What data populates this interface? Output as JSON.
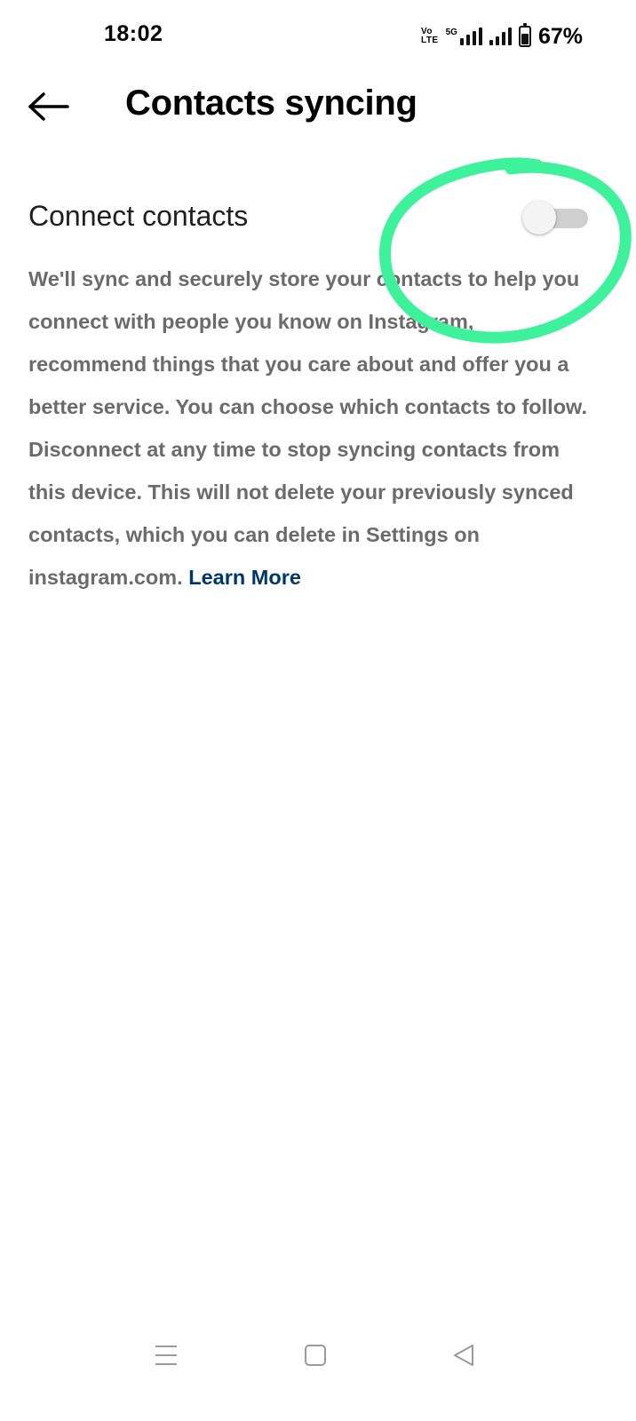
{
  "status_bar": {
    "time": "18:02",
    "volte_line1": "Vo",
    "volte_line2": "LTE",
    "network_label": "5G",
    "battery_percent": "67%",
    "battery_level": 0.67
  },
  "header": {
    "title": "Contacts syncing",
    "back_icon": "arrow-left-icon"
  },
  "setting": {
    "label": "Connect contacts",
    "toggle_on": false
  },
  "description": {
    "text": "We'll sync and securely store your contacts to help you connect with people you know on Instagram, recommend things that you care about and offer you a better service. You can choose which contacts to follow. Disconnect at any time to stop syncing contacts from this device. This will not delete your previously synced contacts, which you can delete in Settings on instagram.com.",
    "link_text": "Learn More"
  },
  "nav_bar": {
    "icons": [
      "menu-icon",
      "home-square-icon",
      "back-triangle-icon"
    ]
  },
  "colors": {
    "annotation": "#3DF29A",
    "link": "#00376b",
    "body_text": "#6b6b6b"
  }
}
